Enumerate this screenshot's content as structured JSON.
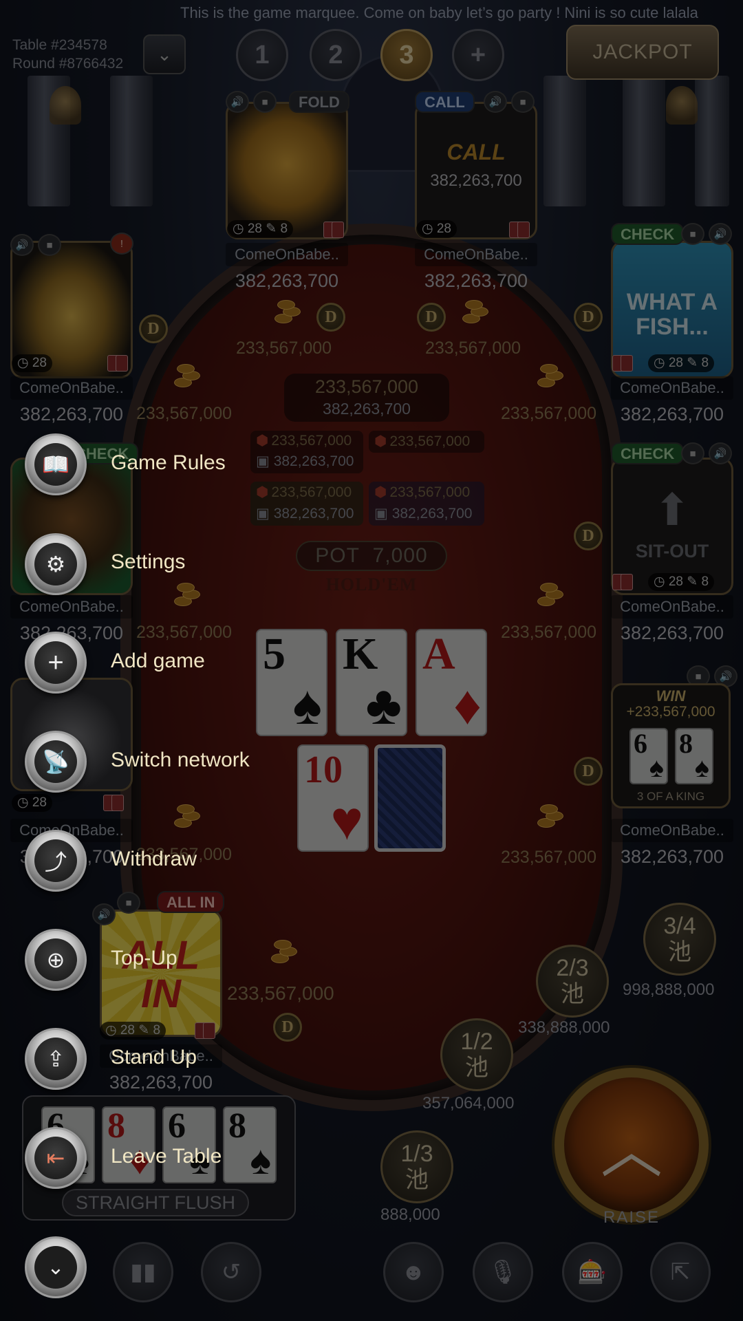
{
  "marquee": "This is the game marquee. Come on baby let’s go party ! Nini is so cute lalala",
  "table_info": {
    "table": "Table #234578",
    "round": "Round #8766432"
  },
  "room_tabs": [
    "1",
    "2",
    "3",
    "+"
  ],
  "active_tab": "3",
  "jackpot_label": "JACKPOT",
  "seats": [
    {
      "id": "top-left",
      "tag": "FOLD",
      "name": "ComeOnBabe..",
      "chips": "382,263,700",
      "timer": "28",
      "edits": "8"
    },
    {
      "id": "top-right",
      "tag": "CALL",
      "action": "CALL",
      "action_amount": "382,263,700",
      "name": "ComeOnBabe..",
      "chips": "382,263,700",
      "timer": "28"
    },
    {
      "id": "left-1",
      "name": "ComeOnBabe..",
      "chips": "382,263,700",
      "timer": "28"
    },
    {
      "id": "right-1",
      "tag": "CHECK",
      "avatar_text": "WHAT A FISH...",
      "name": "ComeOnBabe..",
      "chips": "382,263,700",
      "timer": "28",
      "edits": "8"
    },
    {
      "id": "left-2",
      "tag": "CHECK",
      "name": "ComeOnBabe..",
      "chips": "382,263,700"
    },
    {
      "id": "right-2",
      "tag": "CHECK",
      "avatar_text": "SIT-OUT",
      "name": "ComeOnBabe..",
      "chips": "382,263,700",
      "timer": "28",
      "edits": "8"
    },
    {
      "id": "left-3",
      "name": "ComeOnBabe..",
      "chips": "382,263,700",
      "timer": "28"
    },
    {
      "id": "right-3",
      "win_label": "WIN",
      "win_amount": "+233,567,000",
      "win_hand": "3 OF A KING",
      "name": "ComeOnBabe..",
      "chips": "382,263,700"
    },
    {
      "id": "bottom-left",
      "tag": "ALL IN",
      "avatar_text": "ALL IN",
      "name": "ComeOnBabe..",
      "chips": "382,263,700",
      "timer": "28",
      "edits": "8"
    }
  ],
  "bets": {
    "top_left": "233,567,000",
    "top_right": "233,567,000",
    "left_1": "233,567,000",
    "right_1": "233,567,000",
    "left_2": "233,567,000",
    "right_2": "233,567,000",
    "left_3": "233,567,000",
    "right_3": "233,567,000",
    "bottom_left": "233,567,000"
  },
  "main_pot": {
    "amount": "233,567,000",
    "stack": "382,263,700"
  },
  "side_pots": [
    {
      "amount": "233,567,000",
      "stack": "382,263,700"
    },
    {
      "amount": "233,567,000"
    },
    {
      "amount": "233,567,000",
      "stack": "382,263,700"
    },
    {
      "amount": "233,567,000",
      "stack": "382,263,700"
    }
  ],
  "pot": {
    "label": "POT",
    "amount": "7,000"
  },
  "game_type": "HOLD'EM",
  "community_cards": [
    {
      "rank": "5",
      "suit": "♠",
      "color": "black"
    },
    {
      "rank": "K",
      "suit": "♣",
      "color": "black"
    },
    {
      "rank": "A",
      "suit": "♦",
      "color": "red"
    },
    {
      "rank": "10",
      "suit": "♥",
      "color": "red"
    },
    {
      "rank": "",
      "suit": "",
      "color": "back"
    }
  ],
  "win_cards": [
    {
      "rank": "6",
      "suit": "♠"
    },
    {
      "rank": "8",
      "suit": "♠"
    }
  ],
  "my_hand": {
    "cards": [
      {
        "rank": "6",
        "suit": "♠",
        "color": "black"
      },
      {
        "rank": "8",
        "suit": "♦",
        "color": "red"
      },
      {
        "rank": "6",
        "suit": "♠",
        "color": "black"
      },
      {
        "rank": "8",
        "suit": "♠",
        "color": "black"
      }
    ],
    "rank_label": "STRAIGHT FLUSH"
  },
  "pot_ratios": [
    {
      "top": "1/3",
      "bottom": "池",
      "amount": "888,000"
    },
    {
      "top": "1/2",
      "bottom": "池",
      "amount": "357,064,000"
    },
    {
      "top": "2/3",
      "bottom": "池",
      "amount": "338,888,000"
    },
    {
      "top": "3/4",
      "bottom": "池",
      "amount": "998,888,000"
    }
  ],
  "raise_label": "RAISE",
  "menu_items": [
    {
      "label": "Game Rules",
      "icon": "book-icon"
    },
    {
      "label": "Settings",
      "icon": "gear-icon"
    },
    {
      "label": "Add game",
      "icon": "plus-icon"
    },
    {
      "label": "Switch network",
      "icon": "signal-icon"
    },
    {
      "label": "Withdraw",
      "icon": "withdraw-icon"
    },
    {
      "label": "Top-Up",
      "icon": "top-up-icon"
    },
    {
      "label": "Stand Up",
      "icon": "upload-icon"
    },
    {
      "label": "Leave Table",
      "icon": "exit-door-icon"
    }
  ],
  "toolbar": [
    "chevron-down-icon",
    "bar-chart-icon",
    "history-icon",
    "emoji-icon",
    "microphone-icon",
    "slot-machine-icon",
    "share-icon"
  ],
  "colors": {
    "accent_gold": "#c8ae6a",
    "felt": "#6d1e16",
    "check_green": "#1e5a2a",
    "call_blue": "#1f3d72",
    "allin_red": "#7a1b1b"
  }
}
